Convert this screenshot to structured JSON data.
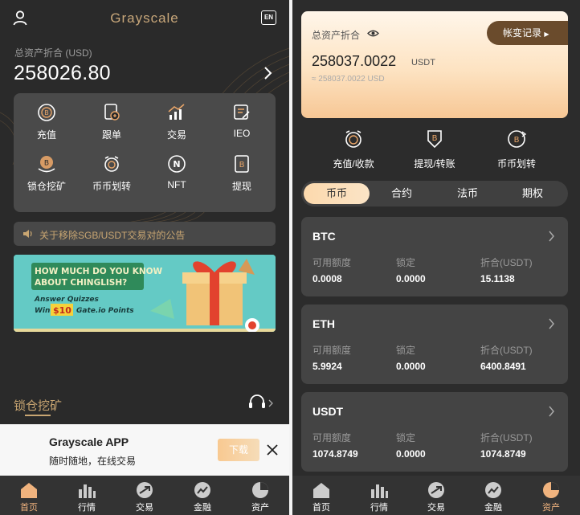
{
  "colors": {
    "gold": "#c9a672",
    "accent": "#f0b37e",
    "bg": "#2a2a2a"
  },
  "home": {
    "brand": "Grayscale",
    "lang_icon": "EN",
    "total_assets_label": "总资产折合 (USD)",
    "total_assets_value": "258026.80",
    "grid": [
      {
        "label": "充值",
        "icon": "deposit-icon"
      },
      {
        "label": "跟单",
        "icon": "copy-trade-icon"
      },
      {
        "label": "交易",
        "icon": "trade-chart-icon"
      },
      {
        "label": "IEO",
        "icon": "ieo-icon"
      },
      {
        "label": "锁仓挖矿",
        "icon": "lock-mining-icon"
      },
      {
        "label": "币币划转",
        "icon": "coin-transfer-icon"
      },
      {
        "label": "NFT",
        "icon": "nft-icon"
      },
      {
        "label": "提现",
        "icon": "withdraw-icon"
      }
    ],
    "notice": "关于移除SGB/USDT交易对的公告",
    "banner": {
      "headline_1": "HOW MUCH DO YOU KNOW",
      "headline_2": "ABOUT CHINGLISH?",
      "line_1": "Answer Quizzes",
      "win": "Win",
      "amount": "$10",
      "line_2": "Gate.io Points"
    },
    "section_title": "锁仓挖矿",
    "app_promo": {
      "title": "Grayscale APP",
      "subtitle": "随时随地，在线交易",
      "download": "下载"
    }
  },
  "tabs": [
    {
      "label": "首页",
      "icon": "home-icon"
    },
    {
      "label": "行情",
      "icon": "market-icon"
    },
    {
      "label": "交易",
      "icon": "trade-icon"
    },
    {
      "label": "金融",
      "icon": "finance-icon"
    },
    {
      "label": "资产",
      "icon": "assets-icon"
    }
  ],
  "assets": {
    "card_label": "总资产折合",
    "records_button": "帐变记录",
    "value": "258037.0022",
    "unit": "USDT",
    "approx": "≈ 258037.0022 USD",
    "actions": [
      {
        "label": "充值/收款",
        "icon": "deposit-receive-icon"
      },
      {
        "label": "提现/转账",
        "icon": "withdraw-transfer-icon"
      },
      {
        "label": "币币划转",
        "icon": "coin-transfer-icon"
      }
    ],
    "segments": [
      "币币",
      "合约",
      "法币",
      "期权"
    ],
    "col_headers": [
      "可用额度",
      "锁定",
      "折合(USDT)"
    ],
    "coins": [
      {
        "name": "BTC",
        "available": "0.0008",
        "locked": "0.0000",
        "equiv": "15.1138"
      },
      {
        "name": "ETH",
        "available": "5.9924",
        "locked": "0.0000",
        "equiv": "6400.8491"
      },
      {
        "name": "USDT",
        "available": "1074.8749",
        "locked": "0.0000",
        "equiv": "1074.8749"
      }
    ]
  }
}
